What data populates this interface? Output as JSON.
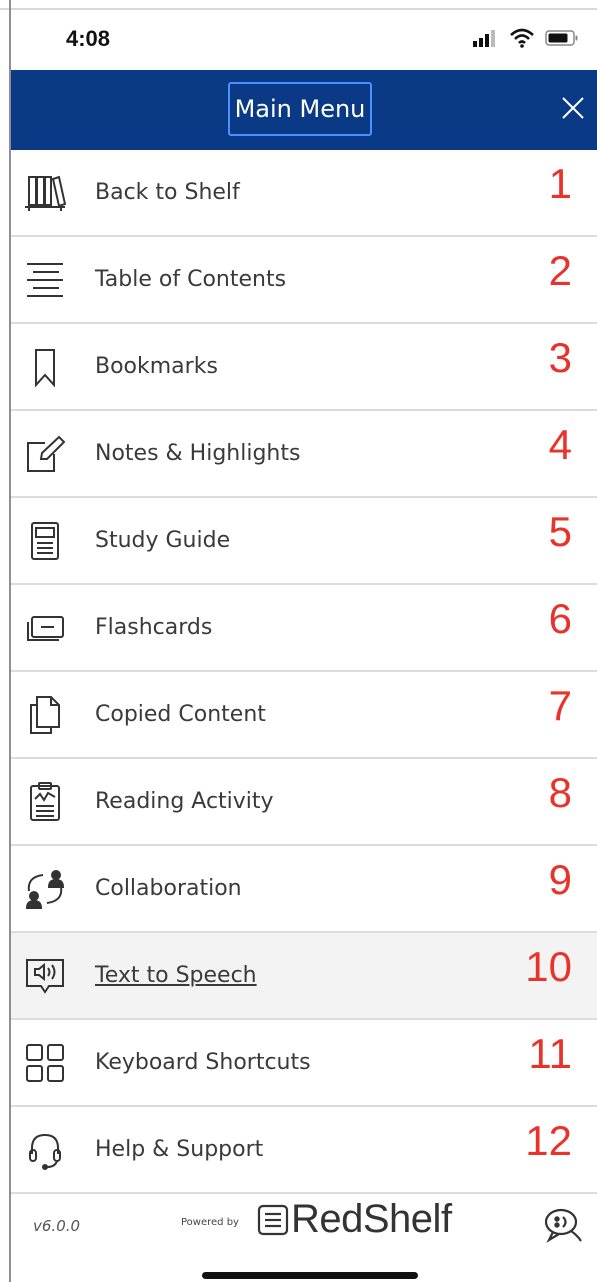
{
  "status_bar": {
    "time": "4:08"
  },
  "header": {
    "title": "Main Menu",
    "close_icon": "close-icon",
    "bg_color": "#0a3a85"
  },
  "menu": {
    "items": [
      {
        "label": "Back to Shelf",
        "number": "1",
        "icon": "bookshelf-icon"
      },
      {
        "label": "Table of Contents",
        "number": "2",
        "icon": "list-lines-icon"
      },
      {
        "label": "Bookmarks",
        "number": "3",
        "icon": "bookmark-icon"
      },
      {
        "label": "Notes & Highlights",
        "number": "4",
        "icon": "note-pencil-icon"
      },
      {
        "label": "Study Guide",
        "number": "5",
        "icon": "study-guide-icon"
      },
      {
        "label": "Flashcards",
        "number": "6",
        "icon": "flashcards-icon"
      },
      {
        "label": "Copied Content",
        "number": "7",
        "icon": "copy-icon"
      },
      {
        "label": "Reading Activity",
        "number": "8",
        "icon": "clipboard-activity-icon"
      },
      {
        "label": "Collaboration",
        "number": "9",
        "icon": "collaboration-icon"
      },
      {
        "label": "Text to Speech",
        "number": "10",
        "icon": "speaker-book-icon",
        "active": true
      },
      {
        "label": "Keyboard Shortcuts",
        "number": "11",
        "icon": "grid-squares-icon"
      },
      {
        "label": "Help & Support",
        "number": "12",
        "icon": "headset-icon"
      }
    ],
    "number_color": "#e8322a"
  },
  "footer": {
    "version": "v6.0.0",
    "powered_by": "Powered by",
    "brand": "RedShelf",
    "chat_icon": "chat-bubble-icon"
  }
}
